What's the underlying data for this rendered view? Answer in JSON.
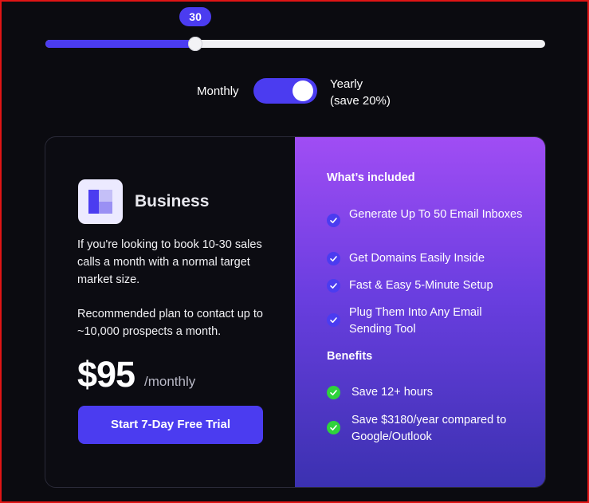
{
  "slider": {
    "value": 30,
    "fraction": 0.3
  },
  "billing_toggle": {
    "left_label": "Monthly",
    "right_label_line1": "Yearly",
    "right_label_line2": "(save 20%)",
    "selected": "Yearly"
  },
  "plan": {
    "name": "Business",
    "description_1": "If you're looking to book 10-30 sales calls a month with a normal target market size.",
    "description_2": "Recommended plan to contact up to ~10,000 prospects a month.",
    "price": "$95",
    "period": "/monthly",
    "cta_label": "Start 7-Day Free Trial"
  },
  "included": {
    "title": "What’s included",
    "items": [
      "Generate Up To 50 Email Inboxes",
      "Get Domains Easily Inside",
      "Fast & Easy 5-Minute Setup",
      "Plug Them Into Any Email Sending Tool"
    ]
  },
  "benefits": {
    "title": "Benefits",
    "items": [
      "Save 12+ hours",
      "Save $3180/year compared to Google/Outlook"
    ]
  },
  "colors": {
    "accent": "#4b3cf0",
    "check_green": "#2fd23c",
    "background": "#0b0b10"
  }
}
